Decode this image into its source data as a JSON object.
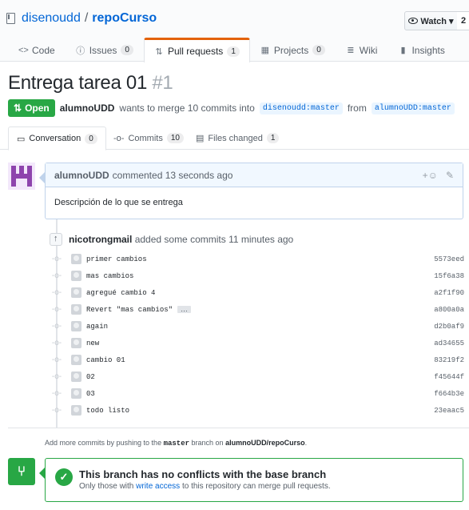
{
  "repo": {
    "owner": "disenoudd",
    "separator": "/",
    "name": "repoCurso",
    "watch_label": "Watch ▾",
    "watch_count": "2"
  },
  "reponav": [
    {
      "label": "Code",
      "icon": "<>",
      "count": null
    },
    {
      "label": "Issues",
      "icon": "ⓘ",
      "count": "0"
    },
    {
      "label": "Pull requests",
      "icon": "⇅",
      "count": "1"
    },
    {
      "label": "Projects",
      "icon": "▦",
      "count": "0"
    },
    {
      "label": "Wiki",
      "icon": "≣",
      "count": null
    },
    {
      "label": "Insights",
      "icon": "▮",
      "count": null
    }
  ],
  "pr": {
    "title": "Entrega tarea 01",
    "number": "#1",
    "state": "Open",
    "author": "alumnoUDD",
    "meta_text": "wants to merge 10 commits into",
    "base_branch": "disenoudd:master",
    "from_text": "from",
    "head_branch": "alumnoUDD:master"
  },
  "tabs": [
    {
      "label": "Conversation",
      "count": "0"
    },
    {
      "label": "Commits",
      "count": "10"
    },
    {
      "label": "Files changed",
      "count": "1"
    }
  ],
  "comment": {
    "author": "alumnoUDD",
    "action": "commented 13 seconds ago",
    "body": "Descripción de lo que se entrega",
    "reaction_icon": "+☺",
    "edit_icon": "✎"
  },
  "commits_event": {
    "author": "nicotrongmail",
    "text": "added some commits 11 minutes ago"
  },
  "commits": [
    {
      "message": "primer cambios",
      "sha": "5573eed"
    },
    {
      "message": "mas cambios",
      "sha": "15f6a38"
    },
    {
      "message": "agregué cambio 4",
      "sha": "a2f1f90"
    },
    {
      "message": "Revert \"mas cambios\"",
      "sha": "a800a0a",
      "more": "…"
    },
    {
      "message": "again",
      "sha": "d2b0af9"
    },
    {
      "message": "new",
      "sha": "ad34655"
    },
    {
      "message": "cambio 01",
      "sha": "83219f2"
    },
    {
      "message": "02",
      "sha": "f45644f"
    },
    {
      "message": "03",
      "sha": "f664b3e"
    },
    {
      "message": "todo listo",
      "sha": "23eaac5"
    }
  ],
  "add_hint": {
    "prefix": "Add more commits by pushing to the",
    "branch": "master",
    "middle": "branch on",
    "repo": "alumnoUDD/repoCurso",
    "suffix": "."
  },
  "merge": {
    "title": "This branch has no conflicts with the base branch",
    "sub_prefix": "Only those with",
    "sub_link": "write access",
    "sub_suffix": "to this repository can merge pull requests."
  },
  "colors": {
    "open": "#28a745",
    "link": "#0366d6",
    "selected_tab": "#e36209",
    "avatar": "#8e44ad"
  }
}
